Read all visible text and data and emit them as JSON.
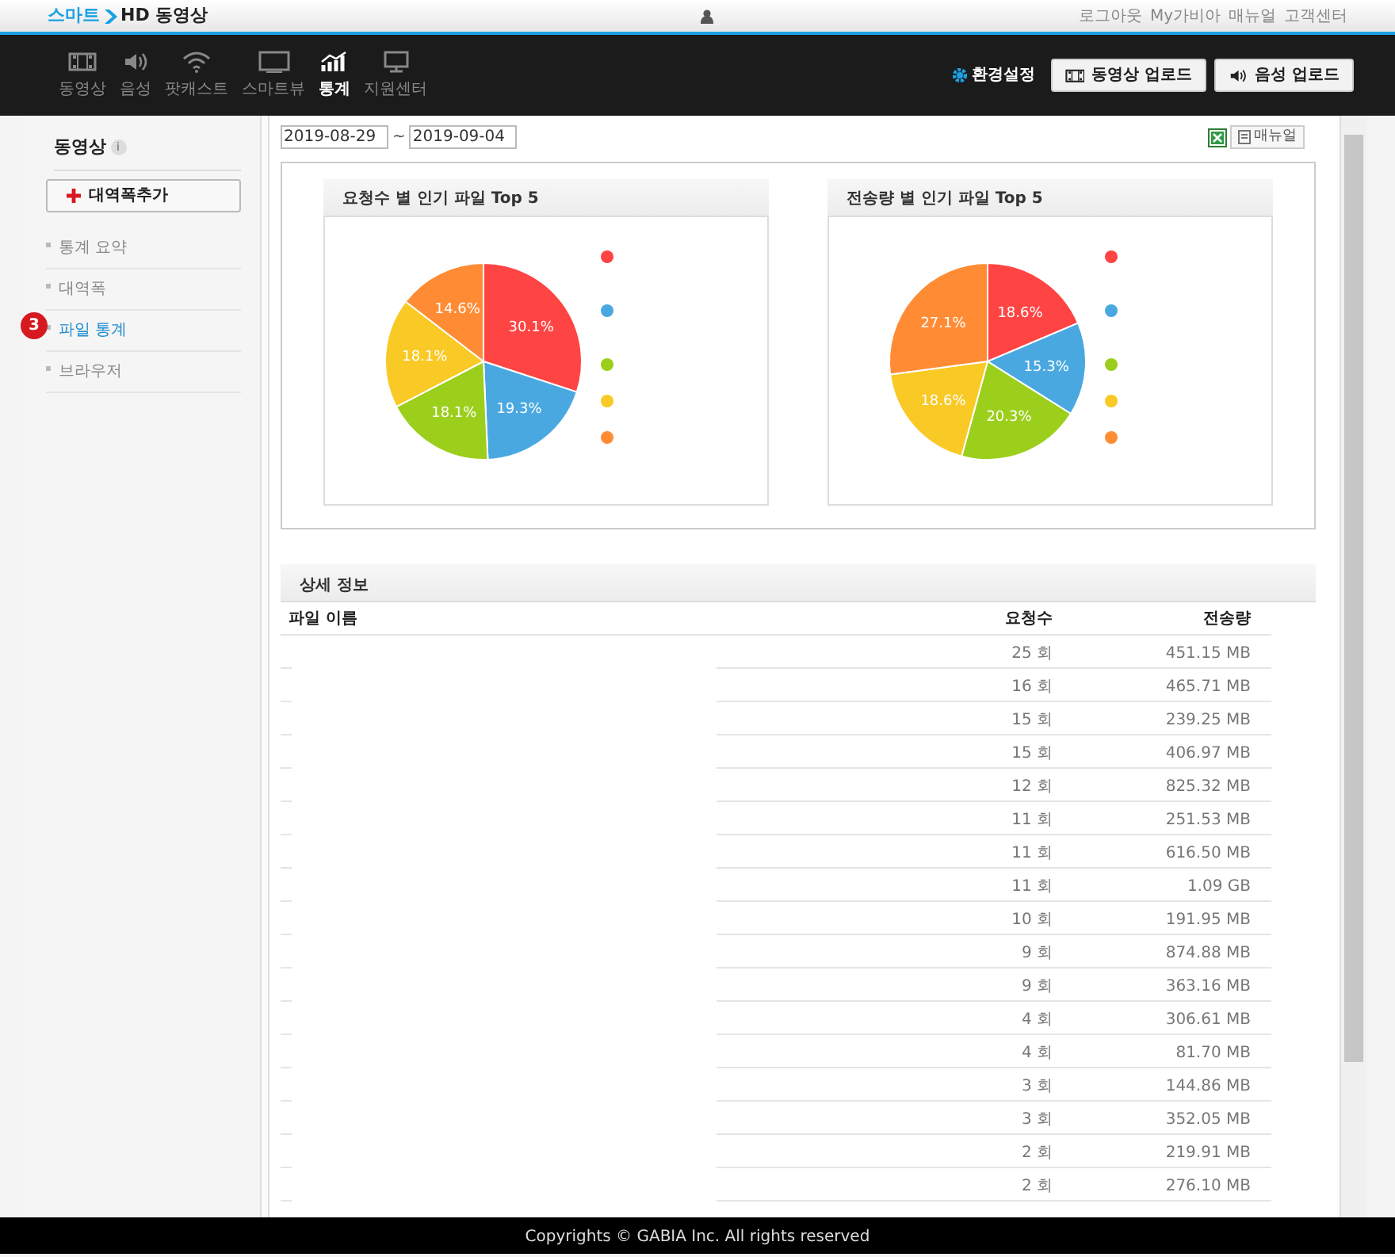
{
  "header": {
    "logo": {
      "brand": "스마트",
      "product": "HD 동영상"
    },
    "links": [
      "로그아웃",
      "My가비아",
      "매뉴얼",
      "고객센터"
    ]
  },
  "nav": {
    "items": [
      {
        "label": "동영상",
        "kind": "film",
        "selected": false
      },
      {
        "label": "음성",
        "kind": "speaker",
        "selected": false
      },
      {
        "label": "팟캐스트",
        "kind": "wifi",
        "selected": false
      },
      {
        "label": "스마트뷰",
        "kind": "screen",
        "selected": false
      },
      {
        "label": "통계",
        "kind": "chart",
        "selected": true
      },
      {
        "label": "지원센터",
        "kind": "monitor",
        "selected": false
      }
    ],
    "settings": "환경설정",
    "buttons": [
      {
        "label": "동영상 업로드",
        "kind": "film"
      },
      {
        "label": "음성 업로드",
        "kind": "speaker"
      }
    ]
  },
  "sidebar": {
    "title": "동영상",
    "info": "i",
    "add_button": "대역폭추가",
    "step_badge": "3",
    "items": [
      {
        "label": "통계 요약",
        "selected": false
      },
      {
        "label": "대역폭",
        "selected": false
      },
      {
        "label": "파일 통계",
        "selected": true
      },
      {
        "label": "브라우저",
        "selected": false
      }
    ]
  },
  "date_range": {
    "start": "2019-08-29",
    "separator": "~",
    "end": "2019-09-04"
  },
  "manual_button": "매뉴얼",
  "charts": [
    {
      "chart_data": {
        "type": "pie",
        "title": "요청수 별 인기 파일 Top 5",
        "values": [
          30.1,
          19.3,
          18.1,
          18.1,
          14.6
        ],
        "value_labels": [
          "30.1%",
          "19.3%",
          "18.1%",
          "18.1%",
          "14.6%"
        ],
        "colors": [
          "#ff4444",
          "#4aa8e0",
          "#9ccf1c",
          "#f9c925",
          "#ff8c35"
        ]
      }
    },
    {
      "chart_data": {
        "type": "pie",
        "title": "전송량 별 인기 파일 Top 5",
        "values": [
          18.6,
          15.3,
          20.3,
          18.6,
          27.1
        ],
        "value_labels": [
          "18.6%",
          "15.3%",
          "20.3%",
          "18.6%",
          "27.1%"
        ],
        "colors": [
          "#ff4444",
          "#4aa8e0",
          "#9ccf1c",
          "#f9c925",
          "#ff8c35"
        ]
      }
    }
  ],
  "detail": {
    "title": "상세 정보",
    "columns": [
      "파일 이름",
      "요청수",
      "전송량"
    ],
    "rows": [
      {
        "requests": "25 회",
        "transfer": "451.15 MB"
      },
      {
        "requests": "16 회",
        "transfer": "465.71 MB"
      },
      {
        "requests": "15 회",
        "transfer": "239.25 MB"
      },
      {
        "requests": "15 회",
        "transfer": "406.97 MB"
      },
      {
        "requests": "12 회",
        "transfer": "825.32 MB"
      },
      {
        "requests": "11 회",
        "transfer": "251.53 MB"
      },
      {
        "requests": "11 회",
        "transfer": "616.50 MB"
      },
      {
        "requests": "11 회",
        "transfer": "1.09 GB"
      },
      {
        "requests": "10 회",
        "transfer": "191.95 MB"
      },
      {
        "requests": "9 회",
        "transfer": "874.88 MB"
      },
      {
        "requests": "9 회",
        "transfer": "363.16 MB"
      },
      {
        "requests": "4 회",
        "transfer": "306.61 MB"
      },
      {
        "requests": "4 회",
        "transfer": "81.70 MB"
      },
      {
        "requests": "3 회",
        "transfer": "144.86 MB"
      },
      {
        "requests": "3 회",
        "transfer": "352.05 MB"
      },
      {
        "requests": "2 회",
        "transfer": "219.91 MB"
      },
      {
        "requests": "2 회",
        "transfer": "276.10 MB"
      }
    ]
  },
  "footer": "Copyrights © GABIA Inc. All rights reserved"
}
